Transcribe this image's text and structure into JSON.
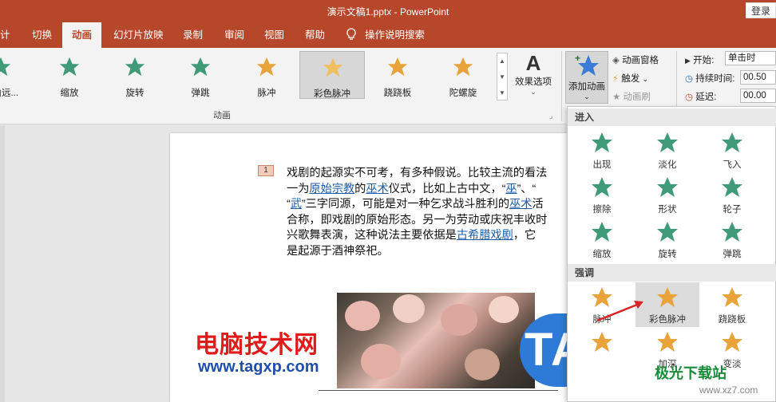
{
  "window": {
    "title": "演示文稿1.pptx  -  PowerPoint",
    "login_label": "登录"
  },
  "tabs": [
    {
      "label": "计"
    },
    {
      "label": "切换"
    },
    {
      "label": "动画"
    },
    {
      "label": "幻灯片放映"
    },
    {
      "label": "录制"
    },
    {
      "label": "审阅"
    },
    {
      "label": "视图"
    },
    {
      "label": "帮助"
    },
    {
      "label": "操作说明搜索"
    }
  ],
  "ribbon": {
    "gallery": [
      {
        "label": "式由远...",
        "icon": "fly-in-star-icon",
        "color": "#3f9a78"
      },
      {
        "label": "缩放",
        "icon": "zoom-star-icon",
        "color": "#3f9a78"
      },
      {
        "label": "旋转",
        "icon": "spin-star-icon",
        "color": "#3f9a78"
      },
      {
        "label": "弹跳",
        "icon": "bounce-star-icon",
        "color": "#3f9a78"
      },
      {
        "label": "脉冲",
        "icon": "pulse-star-icon",
        "color": "#e8a33a"
      },
      {
        "label": "彩色脉冲",
        "icon": "color-pulse-star-icon",
        "color": "#f0c060"
      },
      {
        "label": "跷跷板",
        "icon": "teeter-star-icon",
        "color": "#e8a33a"
      },
      {
        "label": "陀螺旋",
        "icon": "spinner-star-icon",
        "color": "#e8a33a"
      }
    ],
    "effect_options_label": "效果选项",
    "group_label_animation": "动画",
    "add_animation_label": "添加动画",
    "animation_pane_label": "动画窗格",
    "trigger_label": "触发",
    "animation_painter_label": "动画刷",
    "start_label": "开始:",
    "start_value": "单击时",
    "duration_label": "持续时间:",
    "duration_value": "00.50",
    "delay_label": "延迟:",
    "delay_value": "00.00"
  },
  "slide": {
    "animation_number": "1",
    "lines": [
      [
        {
          "t": "戏剧的起源实不可考，有多种假说。比较主流的看法"
        }
      ],
      [
        {
          "t": "一为"
        },
        {
          "t": "原始宗教",
          "link": true
        },
        {
          "t": "的"
        },
        {
          "t": "巫术",
          "link": true
        },
        {
          "t": "仪式，比如上古中文，“"
        },
        {
          "t": "巫",
          "link": true
        },
        {
          "t": "”、“"
        }
      ],
      [
        {
          "t": "“"
        },
        {
          "t": "武",
          "link": true
        },
        {
          "t": "”三字同源，可能是对一种乞求战斗胜利的"
        },
        {
          "t": "巫术",
          "link": true
        },
        {
          "t": "活"
        }
      ],
      [
        {
          "t": "合称，即戏剧的原始形态。另一为劳动或庆祝丰收时"
        }
      ],
      [
        {
          "t": "兴歌舞表演，这种说法主要依据是"
        },
        {
          "t": "古希腊戏剧",
          "link": true
        },
        {
          "t": "，它"
        }
      ],
      [
        {
          "t": "是起源于酒神祭祀。"
        }
      ]
    ],
    "watermark_cn": "电脑技术网",
    "watermark_url": "www.tagxp.com",
    "tag_logo": "TAG"
  },
  "dropdown": {
    "entrance_header": "进入",
    "entrance_items": [
      {
        "label": "出现",
        "icon": "appear-star-icon"
      },
      {
        "label": "淡化",
        "icon": "fade-star-icon"
      },
      {
        "label": "飞入",
        "icon": "fly-in-star-icon"
      },
      {
        "label": "擦除",
        "icon": "wipe-star-icon"
      },
      {
        "label": "形状",
        "icon": "shape-star-icon"
      },
      {
        "label": "轮子",
        "icon": "wheel-star-icon"
      },
      {
        "label": "缩放",
        "icon": "zoom-star-icon"
      },
      {
        "label": "旋转",
        "icon": "spin-star-icon"
      },
      {
        "label": "弹跳",
        "icon": "bounce-star-icon"
      }
    ],
    "emphasis_header": "强调",
    "emphasis_items": [
      {
        "label": "脉冲",
        "icon": "pulse-star-icon"
      },
      {
        "label": "彩色脉冲",
        "icon": "color-pulse-star-icon"
      },
      {
        "label": "跷跷板",
        "icon": "teeter-star-icon"
      },
      {
        "label": "",
        "icon": "star-icon"
      },
      {
        "label": "加深",
        "icon": "darken-star-icon"
      },
      {
        "label": "变淡",
        "icon": "lighten-star-icon"
      }
    ]
  },
  "site_watermark": {
    "name": "极光下载站",
    "url": "www.xz7.com"
  },
  "colors": {
    "accent": "#b7472a",
    "entrance_star": "#3f9a78",
    "emphasis_star": "#e8a33a"
  }
}
